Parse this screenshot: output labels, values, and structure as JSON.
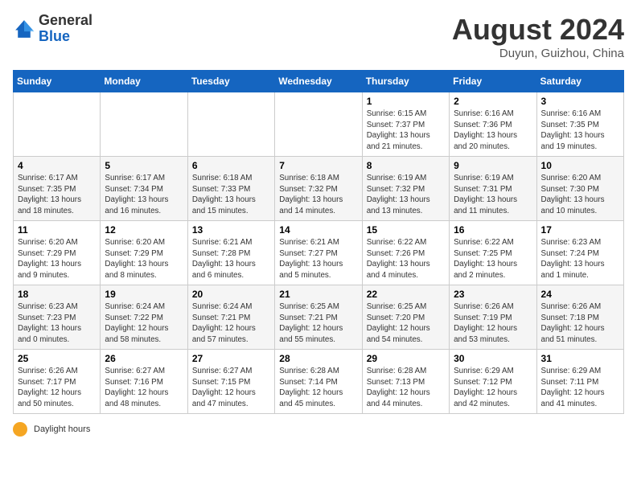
{
  "header": {
    "logo_general": "General",
    "logo_blue": "Blue",
    "month_year": "August 2024",
    "location": "Duyun, Guizhou, China"
  },
  "days_of_week": [
    "Sunday",
    "Monday",
    "Tuesday",
    "Wednesday",
    "Thursday",
    "Friday",
    "Saturday"
  ],
  "weeks": [
    [
      {
        "day": "",
        "detail": ""
      },
      {
        "day": "",
        "detail": ""
      },
      {
        "day": "",
        "detail": ""
      },
      {
        "day": "",
        "detail": ""
      },
      {
        "day": "1",
        "detail": "Sunrise: 6:15 AM\nSunset: 7:37 PM\nDaylight: 13 hours\nand 21 minutes."
      },
      {
        "day": "2",
        "detail": "Sunrise: 6:16 AM\nSunset: 7:36 PM\nDaylight: 13 hours\nand 20 minutes."
      },
      {
        "day": "3",
        "detail": "Sunrise: 6:16 AM\nSunset: 7:35 PM\nDaylight: 13 hours\nand 19 minutes."
      }
    ],
    [
      {
        "day": "4",
        "detail": "Sunrise: 6:17 AM\nSunset: 7:35 PM\nDaylight: 13 hours\nand 18 minutes."
      },
      {
        "day": "5",
        "detail": "Sunrise: 6:17 AM\nSunset: 7:34 PM\nDaylight: 13 hours\nand 16 minutes."
      },
      {
        "day": "6",
        "detail": "Sunrise: 6:18 AM\nSunset: 7:33 PM\nDaylight: 13 hours\nand 15 minutes."
      },
      {
        "day": "7",
        "detail": "Sunrise: 6:18 AM\nSunset: 7:32 PM\nDaylight: 13 hours\nand 14 minutes."
      },
      {
        "day": "8",
        "detail": "Sunrise: 6:19 AM\nSunset: 7:32 PM\nDaylight: 13 hours\nand 13 minutes."
      },
      {
        "day": "9",
        "detail": "Sunrise: 6:19 AM\nSunset: 7:31 PM\nDaylight: 13 hours\nand 11 minutes."
      },
      {
        "day": "10",
        "detail": "Sunrise: 6:20 AM\nSunset: 7:30 PM\nDaylight: 13 hours\nand 10 minutes."
      }
    ],
    [
      {
        "day": "11",
        "detail": "Sunrise: 6:20 AM\nSunset: 7:29 PM\nDaylight: 13 hours\nand 9 minutes."
      },
      {
        "day": "12",
        "detail": "Sunrise: 6:20 AM\nSunset: 7:29 PM\nDaylight: 13 hours\nand 8 minutes."
      },
      {
        "day": "13",
        "detail": "Sunrise: 6:21 AM\nSunset: 7:28 PM\nDaylight: 13 hours\nand 6 minutes."
      },
      {
        "day": "14",
        "detail": "Sunrise: 6:21 AM\nSunset: 7:27 PM\nDaylight: 13 hours\nand 5 minutes."
      },
      {
        "day": "15",
        "detail": "Sunrise: 6:22 AM\nSunset: 7:26 PM\nDaylight: 13 hours\nand 4 minutes."
      },
      {
        "day": "16",
        "detail": "Sunrise: 6:22 AM\nSunset: 7:25 PM\nDaylight: 13 hours\nand 2 minutes."
      },
      {
        "day": "17",
        "detail": "Sunrise: 6:23 AM\nSunset: 7:24 PM\nDaylight: 13 hours\nand 1 minute."
      }
    ],
    [
      {
        "day": "18",
        "detail": "Sunrise: 6:23 AM\nSunset: 7:23 PM\nDaylight: 13 hours\nand 0 minutes."
      },
      {
        "day": "19",
        "detail": "Sunrise: 6:24 AM\nSunset: 7:22 PM\nDaylight: 12 hours\nand 58 minutes."
      },
      {
        "day": "20",
        "detail": "Sunrise: 6:24 AM\nSunset: 7:21 PM\nDaylight: 12 hours\nand 57 minutes."
      },
      {
        "day": "21",
        "detail": "Sunrise: 6:25 AM\nSunset: 7:21 PM\nDaylight: 12 hours\nand 55 minutes."
      },
      {
        "day": "22",
        "detail": "Sunrise: 6:25 AM\nSunset: 7:20 PM\nDaylight: 12 hours\nand 54 minutes."
      },
      {
        "day": "23",
        "detail": "Sunrise: 6:26 AM\nSunset: 7:19 PM\nDaylight: 12 hours\nand 53 minutes."
      },
      {
        "day": "24",
        "detail": "Sunrise: 6:26 AM\nSunset: 7:18 PM\nDaylight: 12 hours\nand 51 minutes."
      }
    ],
    [
      {
        "day": "25",
        "detail": "Sunrise: 6:26 AM\nSunset: 7:17 PM\nDaylight: 12 hours\nand 50 minutes."
      },
      {
        "day": "26",
        "detail": "Sunrise: 6:27 AM\nSunset: 7:16 PM\nDaylight: 12 hours\nand 48 minutes."
      },
      {
        "day": "27",
        "detail": "Sunrise: 6:27 AM\nSunset: 7:15 PM\nDaylight: 12 hours\nand 47 minutes."
      },
      {
        "day": "28",
        "detail": "Sunrise: 6:28 AM\nSunset: 7:14 PM\nDaylight: 12 hours\nand 45 minutes."
      },
      {
        "day": "29",
        "detail": "Sunrise: 6:28 AM\nSunset: 7:13 PM\nDaylight: 12 hours\nand 44 minutes."
      },
      {
        "day": "30",
        "detail": "Sunrise: 6:29 AM\nSunset: 7:12 PM\nDaylight: 12 hours\nand 42 minutes."
      },
      {
        "day": "31",
        "detail": "Sunrise: 6:29 AM\nSunset: 7:11 PM\nDaylight: 12 hours\nand 41 minutes."
      }
    ]
  ],
  "footer": {
    "daylight_label": "Daylight hours"
  }
}
